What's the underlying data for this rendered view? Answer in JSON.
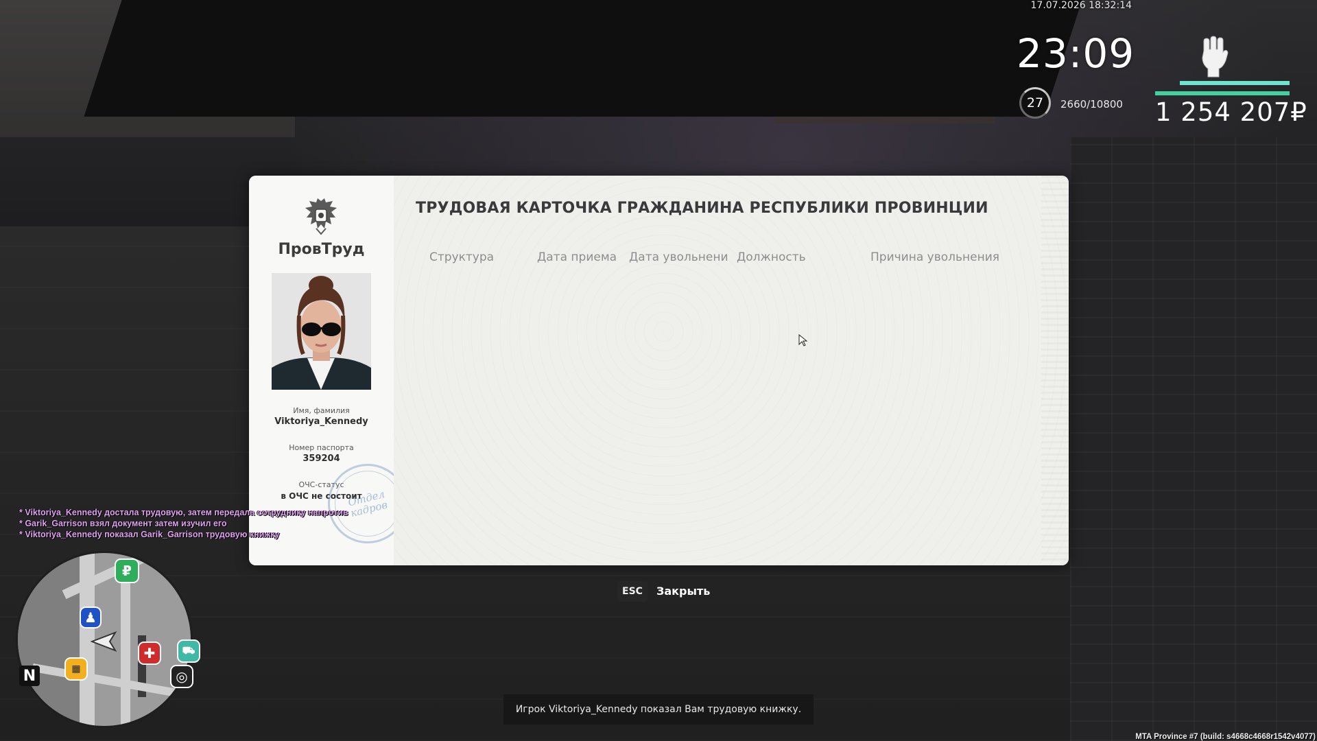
{
  "hud": {
    "datetime": "17.07.2026 18:32:14",
    "clock": "23:09",
    "level": "27",
    "experience": "2660/10800",
    "money": "1 254 207₽",
    "status_icon": "raised-fist-icon",
    "colors": {
      "bar_top": "#6fe3cf",
      "bar_bottom": "#45d0a0"
    }
  },
  "document": {
    "org_name": "ПровТруд",
    "title": "ТРУДОВАЯ КАРТОЧКА ГРАЖДАНИНА РЕСПУБЛИКИ ПРОВИНЦИИ",
    "fields": {
      "name_label": "Имя, фамилия",
      "name_value": "Viktoriya_Kennedy",
      "passport_label": "Номер паспорта",
      "passport_value": "359204",
      "status_label": "ОЧС-статус",
      "status_value": "в ОЧС не состоит"
    },
    "stamp_text": [
      "Отдел",
      "кадров"
    ],
    "columns": [
      "Структура",
      "Дата приема",
      "Дата увольнени",
      "Должность",
      "Причина увольнения"
    ],
    "rows": []
  },
  "chat": [
    "* Viktoriya_Kennedy достала трудовую, затем передала сотруднику напротив",
    "* Garik_Garrison взял документ затем изучил его",
    "* Viktoriya_Kennedy показал Garik_Garrison трудовую книжку"
  ],
  "controls": {
    "close_key": "ESC",
    "close_label": "Закрыть"
  },
  "notice": "Игрок Viktoriya_Kennedy показал Вам трудовую книжку.",
  "build_info": "MTA Province #7 (build: s4668c4668r1542v4077)",
  "minimap": {
    "north_label": "N",
    "icons": [
      "ruble-icon",
      "police-icon",
      "hospital-icon",
      "taxi-icon",
      "car-service-icon",
      "target-icon",
      "player-arrow-icon"
    ]
  }
}
